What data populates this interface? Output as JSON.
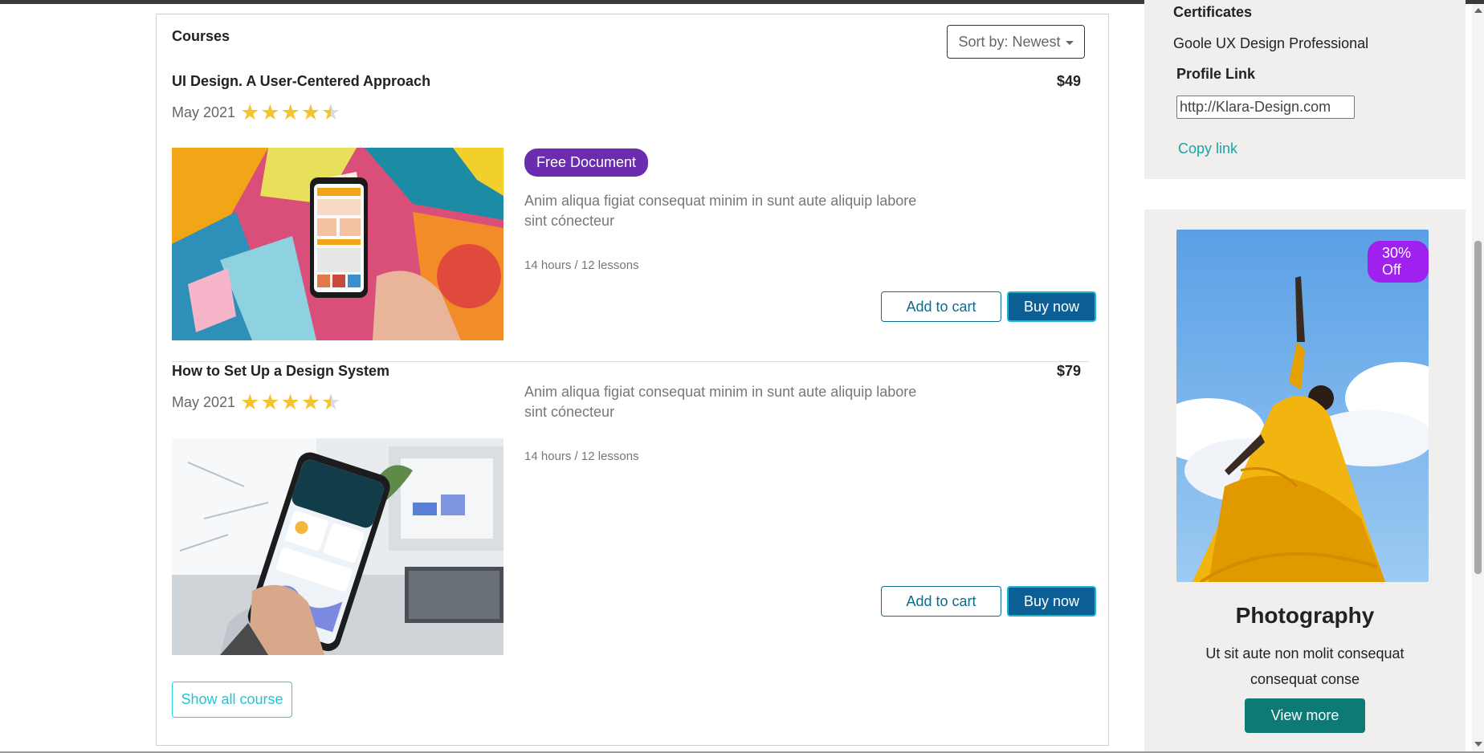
{
  "courses": {
    "title": "Courses",
    "sort_label": "Sort by: Newest",
    "show_all_label": "Show all course",
    "items": [
      {
        "title": "UI Design. A User-Centered Approach",
        "price": "$49",
        "date": "May 2021",
        "rating": 4.5,
        "badge": "Free Document",
        "description": "Anim aliqua figiat consequat minim in sunt aute aliquip labore sint cónecteur",
        "meta": "14 hours / 12 lessons",
        "add_to_cart_label": "Add to cart",
        "buy_now_label": "Buy now"
      },
      {
        "title": "How to Set Up a Design System",
        "price": "$79",
        "date": "May 2021",
        "rating": 4.5,
        "description": "Anim aliqua figiat consequat minim in sunt aute aliquip labore sint cónecteur",
        "meta": "14 hours / 12 lessons",
        "add_to_cart_label": "Add to cart",
        "buy_now_label": "Buy now"
      }
    ]
  },
  "sidebar": {
    "certificates_label": "Certificates",
    "certificate_value": "Goole UX Design Professional",
    "profile_link_label": "Profile Link",
    "profile_link_value": "http://Klara-Design.com",
    "copy_link_label": "Copy link",
    "promo": {
      "discount": "30% Off",
      "title": "Photography",
      "text": "Ut sit aute non molit consequat consequat conse",
      "button_label": "View more"
    }
  },
  "colors": {
    "badge_purple": "#6b2cb0",
    "discount_purple": "#a020f0",
    "buy_blue": "#0c5f94",
    "view_more_teal": "#0e7a75",
    "star_yellow": "#f4c430",
    "show_all_cyan": "#1ec6d6"
  }
}
